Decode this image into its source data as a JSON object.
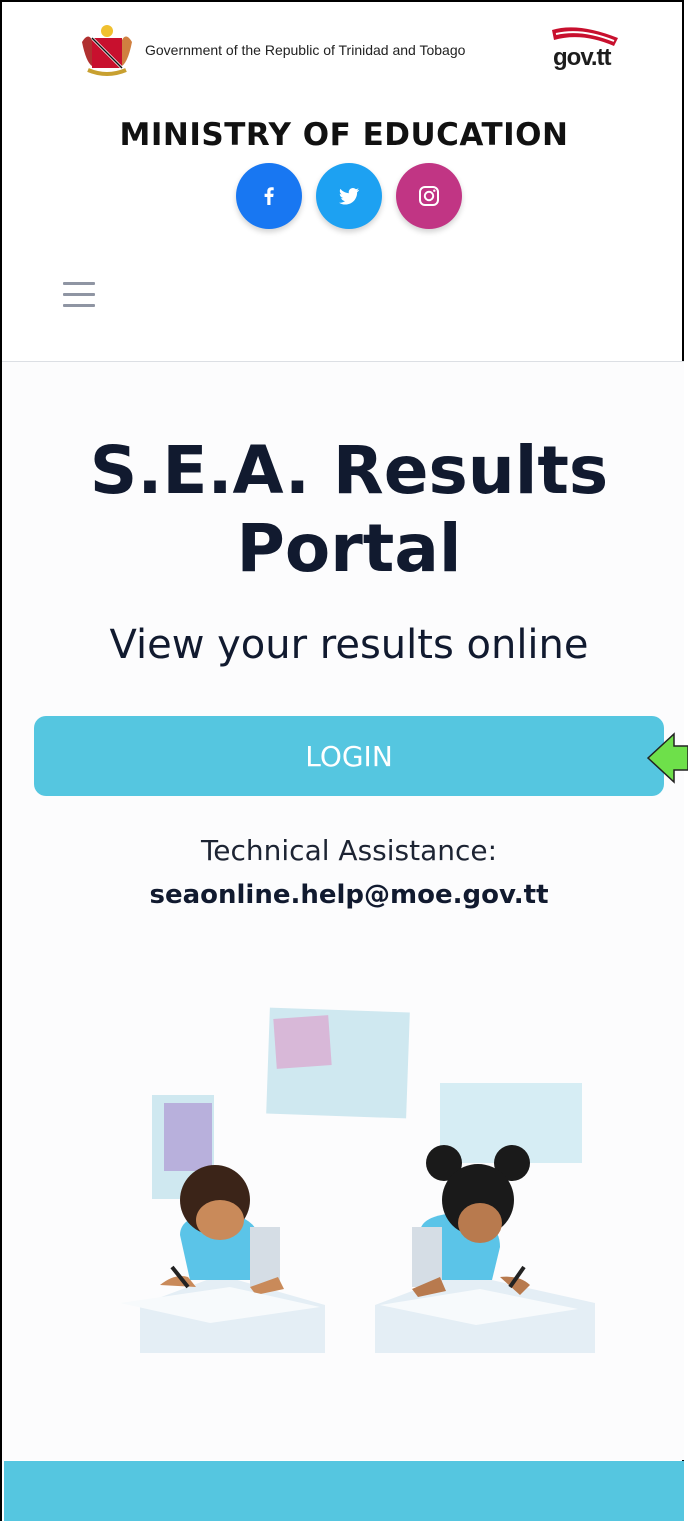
{
  "header": {
    "gov_text": "Government of the Republic of Trinidad and Tobago",
    "govtt_logo_text": "gov.tt",
    "ministry_title": "MINISTRY OF EDUCATION",
    "social_icons": [
      "facebook-icon",
      "twitter-icon",
      "instagram-icon"
    ],
    "menu_icon": "hamburger-menu-icon"
  },
  "hero": {
    "title_line1": "S.E.A. Results",
    "title_line2": "Portal",
    "subtitle": "View your results online",
    "login_label": "LOGIN",
    "tech_label": "Technical Assistance:",
    "tech_email": "seaonline.help@moe.gov.tt"
  },
  "colors": {
    "accent": "#55c6e0",
    "facebook": "#1877f2",
    "twitter": "#1da1f2",
    "instagram": "#c13584",
    "title_text": "#111a2f",
    "annotation_arrow": "#6ee04a"
  }
}
